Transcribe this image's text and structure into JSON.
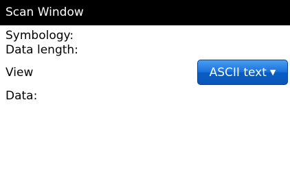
{
  "window": {
    "title": "Scan Window"
  },
  "fields": {
    "symbology_label": "Symbology:",
    "data_length_label": "Data length:",
    "view_label": "View",
    "data_label": "Data:"
  },
  "view_select": {
    "selected": "ASCII text",
    "icon": "triangle-down"
  },
  "colors": {
    "title_bar_bg": "#000000",
    "title_text": "#ffffff",
    "dropdown_bg": "#1a71db"
  }
}
